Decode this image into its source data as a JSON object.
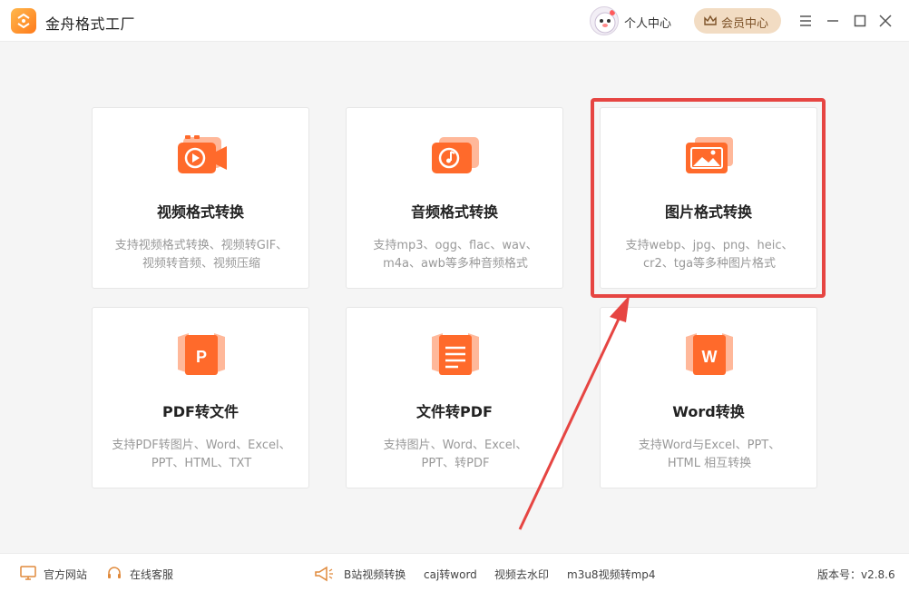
{
  "app": {
    "title": "金舟格式工厂",
    "user_center": "个人中心",
    "vip_center": "会员中心"
  },
  "cards": [
    {
      "title": "视频格式转换",
      "desc_lines": [
        "支持视频格式转换、视频转GIF、",
        "视频转音频、视频压缩"
      ],
      "icon": "video-icon"
    },
    {
      "title": "音频格式转换",
      "desc_lines": [
        "支持mp3、ogg、flac、wav、",
        "m4a、awb等多种音频格式"
      ],
      "icon": "music-icon"
    },
    {
      "title": "图片格式转换",
      "desc_lines": [
        "支持webp、jpg、png、heic、",
        "cr2、tga等多种图片格式"
      ],
      "icon": "image-icon"
    },
    {
      "title": "PDF转文件",
      "desc_lines": [
        "支持PDF转图片、Word、Excel、",
        "PPT、HTML、TXT"
      ],
      "icon": "pdf-icon"
    },
    {
      "title": "文件转PDF",
      "desc_lines": [
        "支持图片、Word、Excel、",
        "PPT、转PDF"
      ],
      "icon": "document-icon"
    },
    {
      "title": "Word转换",
      "desc_lines": [
        "支持Word与Excel、PPT、",
        "HTML 相互转换"
      ],
      "icon": "word-icon"
    }
  ],
  "footer": {
    "official_site": "官方网站",
    "online_service": "在线客服",
    "links": [
      "B站视频转换",
      "caj转word",
      "视频去水印",
      "m3u8视频转mp4"
    ],
    "version": "版本号：v2.8.6"
  },
  "colors": {
    "accent": "#ff6a2b",
    "highlight": "#e64542",
    "vip_bg": "#f2dcc3"
  }
}
